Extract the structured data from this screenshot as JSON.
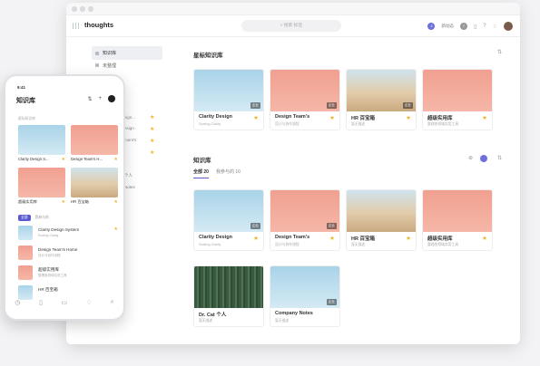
{
  "app": {
    "brand": "thoughts",
    "search_placeholder": "搜索 标签",
    "header_badge": "4",
    "header_link": "新动态",
    "header_badge2": "7"
  },
  "sidebar": {
    "items": [
      {
        "label": "知识库"
      },
      {
        "label": "未整理"
      }
    ],
    "ext": [
      "sign...",
      "esign",
      "ment's",
      "",
      "",
      "个人",
      "Notes"
    ]
  },
  "section1": {
    "title": "星标知识库",
    "cards": [
      {
        "title": "Clarity Design",
        "sub": "Scaling Clarity",
        "tag": "企业",
        "img": "sky"
      },
      {
        "title": "Design Team's",
        "sub": "设计与协作流程",
        "tag": "企业",
        "img": "salmon"
      },
      {
        "title": "HR 百宝箱",
        "sub": "暂无描述",
        "tag": "企业",
        "img": "sand"
      },
      {
        "title": "超级实用库",
        "sub": "整理各领域实用工具",
        "tag": "",
        "img": "salmon"
      }
    ]
  },
  "section2": {
    "title": "知识库",
    "tabs": [
      "全部 20",
      "我参与的 10"
    ],
    "cards": [
      {
        "title": "Clarity Design",
        "sub": "Scaling Clarity",
        "tag": "企业",
        "img": "sky"
      },
      {
        "title": "Design Team's",
        "sub": "设计与协作流程",
        "tag": "企业",
        "img": "salmon"
      },
      {
        "title": "HR 百宝箱",
        "sub": "暂无描述",
        "tag": "",
        "img": "sand"
      },
      {
        "title": "超级实用库",
        "sub": "整理各领域实用工具",
        "tag": "",
        "img": "salmon"
      },
      {
        "title": "Dr. Cat 个人",
        "sub": "暂无描述",
        "tag": "",
        "img": "forest"
      },
      {
        "title": "Company Notes",
        "sub": "暂无描述",
        "tag": "企业",
        "img": "sky"
      }
    ]
  },
  "phone": {
    "time": "9:41",
    "title": "知识库",
    "section": "星标知识库",
    "cards": [
      {
        "title": "Clarity Design S...",
        "img": "sky"
      },
      {
        "title": "Design Team's H...",
        "img": "salmon"
      },
      {
        "title": "超级实用库",
        "img": "salmon"
      },
      {
        "title": "HR 百宝箱",
        "img": "sand"
      }
    ],
    "tabs": [
      "全部",
      "我参与的"
    ],
    "rows": [
      {
        "title": "Clarity Design System",
        "sub": "Scaling Clarity",
        "img": "sky",
        "star": true
      },
      {
        "title": "Design Team's Home",
        "sub": "设计与协作流程",
        "img": "salmon",
        "star": false
      },
      {
        "title": "超级实用库",
        "sub": "整理各领域实用工具",
        "img": "salmon",
        "star": false
      },
      {
        "title": "HR 百宝箱",
        "sub": "",
        "img": "sky",
        "star": false
      }
    ],
    "nav_badge": "3"
  }
}
